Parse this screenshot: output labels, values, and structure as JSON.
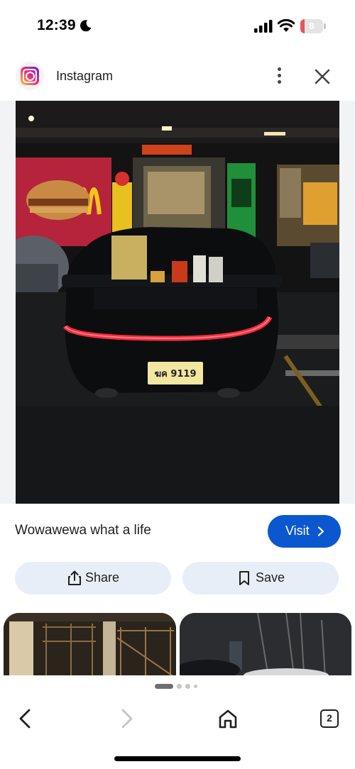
{
  "status_bar": {
    "time": "12:39",
    "battery_level": "8",
    "battery_fraction": 0.08,
    "icons": [
      "moon-icon",
      "signal-icon",
      "wifi-icon",
      "battery-icon"
    ]
  },
  "header": {
    "app_name": "Instagram",
    "icons": [
      "instagram-logo-icon",
      "more-vert-icon",
      "close-icon"
    ]
  },
  "result": {
    "caption": "Wowawewa what a life",
    "visit_label": "Visit",
    "share_label": "Share",
    "save_label": "Save",
    "icons": [
      "chevron-right-icon",
      "share-icon",
      "bookmark-icon"
    ]
  },
  "pager": {
    "page_count": 4,
    "active_index": 0
  },
  "bottom_nav": {
    "tab_count": "2",
    "icons": [
      "back-icon",
      "forward-icon",
      "home-icon",
      "tabs-icon"
    ]
  },
  "colors": {
    "accent": "#0b57d0",
    "action_button_bg": "#e8eef8",
    "battery_low": "#e8545a"
  }
}
